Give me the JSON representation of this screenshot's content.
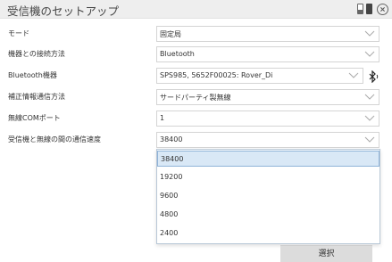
{
  "window": {
    "title": "受信機のセットアップ"
  },
  "fields": [
    {
      "label": "モード",
      "value": "固定局"
    },
    {
      "label": "機器との接続方法",
      "value": "Bluetooth"
    },
    {
      "label": "Bluetooth機器",
      "value": "SPS985, 5652F00025: Rover_Di"
    },
    {
      "label": "補正情報通信方法",
      "value": "サードパーティ製無線"
    },
    {
      "label": "無線COMポート",
      "value": "1"
    },
    {
      "label": "受信機と無線の間の通信速度",
      "value": "38400"
    }
  ],
  "dropdown": {
    "options": [
      "38400",
      "19200",
      "9600",
      "4800",
      "2400"
    ],
    "selected_index": 0
  },
  "actions": {
    "select_label": "選択"
  },
  "icons": {
    "battery": "battery-icon",
    "close": "close-icon",
    "chevron": "chevron-down-icon",
    "bluetooth": "bluetooth-icon"
  },
  "colors": {
    "titlebar": "#eeeeee",
    "selected_option": "#d9e8f6",
    "button": "#dcdcdc"
  }
}
